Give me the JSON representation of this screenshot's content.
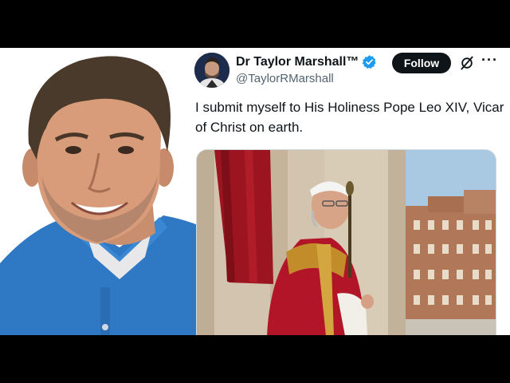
{
  "tweet": {
    "display_name": "Dr Taylor Marshall™",
    "handle": "@TaylorRMarshall",
    "follow_label": "Follow",
    "more_label": "···",
    "text": "I submit myself to His Holiness Pope Leo XIV, Vicar of Christ on earth."
  },
  "icons": {
    "verified": "verified-badge-icon",
    "grok": "grok-icon",
    "more": "more-icon"
  },
  "colors": {
    "background_bars": "#000000",
    "follow_button": "#0f1419",
    "verified_blue": "#1d9bf0",
    "handle_gray": "#536471"
  }
}
